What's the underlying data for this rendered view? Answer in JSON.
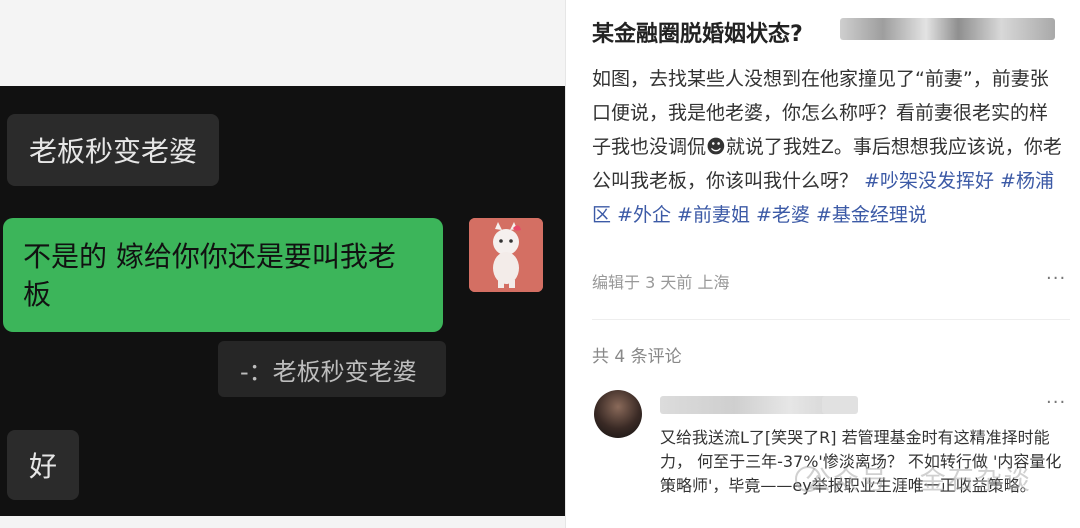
{
  "chat": {
    "msg1": "老板秒变老婆",
    "msg2": "不是的 嫁给你你还是要叫我老板",
    "quote": "-：老板秒变老婆",
    "msg3": "好"
  },
  "post": {
    "title": "某金融圈脱婚姻状态?",
    "body": "如图，去找某些人没想到在他家撞见了“前妻”，前妻张口便说，我是他老婆，你怎么称呼？看前妻很老实的样子我也没调侃",
    "body2": "就说了我姓Z。事后想想我应该说，你老公叫我老板，你该叫我什么呀？",
    "tags": [
      "#吵架没发挥好",
      "#杨浦区",
      "#外企",
      "#前妻姐",
      "#老婆",
      "#基金经理说"
    ],
    "meta": "编辑于 3 天前 上海",
    "more": "···"
  },
  "comments": {
    "count": "共 4 条评论",
    "items": [
      {
        "text": "又给我送流L了[笑哭了R] 若管理基金时有这精准择时能力， 何至于三年-37%'惨淡离场？ 不如转行做 '内容量化策略师'，毕竟——ey举报职业生涯唯一正收益策略。",
        "more": "···"
      }
    ]
  },
  "watermark": "公众号 · 金石杂谈"
}
